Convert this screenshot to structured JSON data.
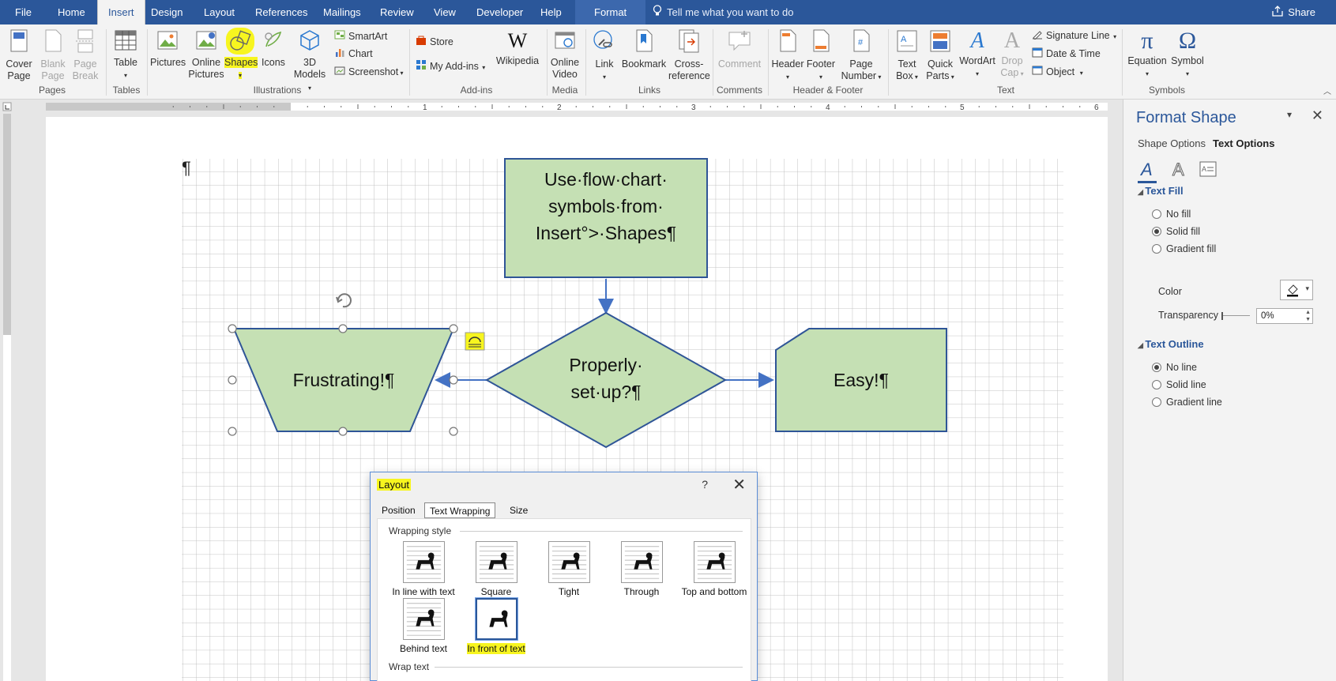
{
  "menubar": {
    "tabs": [
      "File",
      "Home",
      "Insert",
      "Design",
      "Layout",
      "References",
      "Mailings",
      "Review",
      "View",
      "Developer",
      "Help",
      "Format"
    ],
    "active_tab": "Insert",
    "tellme": "Tell me what you want to do",
    "share": "Share"
  },
  "ribbon": {
    "pages": {
      "cover_page": "Cover\nPage",
      "blank_page": "Blank\nPage",
      "page_break": "Page\nBreak",
      "label": "Pages"
    },
    "tables": {
      "table": "Table",
      "label": "Tables"
    },
    "illustrations": {
      "pictures": "Pictures",
      "online_pictures": "Online\nPictures",
      "shapes": "Shapes",
      "icons": "Icons",
      "models3d": "3D\nModels",
      "smartart": "SmartArt",
      "chart": "Chart",
      "screenshot": "Screenshot",
      "label": "Illustrations"
    },
    "addins": {
      "store": "Store",
      "my_addins": "My Add-ins",
      "wikipedia": "Wikipedia",
      "label": "Add-ins"
    },
    "media": {
      "online_video": "Online\nVideo",
      "label": "Media"
    },
    "links": {
      "link": "Link",
      "bookmark": "Bookmark",
      "cross_reference": "Cross-\nreference",
      "label": "Links"
    },
    "comments": {
      "comment": "Comment",
      "label": "Comments"
    },
    "header_footer": {
      "header": "Header",
      "footer": "Footer",
      "page_number": "Page\nNumber",
      "label": "Header & Footer"
    },
    "text": {
      "text_box": "Text\nBox",
      "quick_parts": "Quick\nParts",
      "wordart": "WordArt",
      "drop_cap": "Drop\nCap",
      "signature_line": "Signature Line",
      "date_time": "Date & Time",
      "object": "Object",
      "label": "Text"
    },
    "symbols": {
      "equation": "Equation",
      "symbol": "Symbol",
      "label": "Symbols"
    }
  },
  "document": {
    "pilcrow": "¶",
    "shapes": {
      "top": "Use·flow·chart·\nsymbols·from·\nInsert°>·Shapes¶",
      "left": "Frustrating!¶",
      "diamond": "Properly·\nset·up?¶",
      "right": "Easy!¶"
    },
    "colors": {
      "fill": "#c5e0b4",
      "outline": "#2f5597",
      "grid": "#b4b4b4"
    }
  },
  "pane": {
    "title": "Format Shape",
    "tabs": [
      "Shape Options",
      "Text Options"
    ],
    "active_tab": "Text Options",
    "text_fill": {
      "label": "Text Fill",
      "options": [
        "No fill",
        "Solid fill",
        "Gradient fill"
      ],
      "selected": "Solid fill",
      "color_label": "Color",
      "transparency_label": "Transparency",
      "transparency_value": "0%"
    },
    "text_outline": {
      "label": "Text Outline",
      "options": [
        "No line",
        "Solid line",
        "Gradient line"
      ],
      "selected": "No line"
    }
  },
  "dialog": {
    "title": "Layout",
    "help": "?",
    "tabs": [
      "Position",
      "Text Wrapping",
      "Size"
    ],
    "active_tab": "Text Wrapping",
    "wrapping_style_label": "Wrapping style",
    "styles": [
      "In line with text",
      "Square",
      "Tight",
      "Through",
      "Top and bottom",
      "Behind text",
      "In front of text"
    ],
    "selected_style": "In front of text",
    "wrap_text_label": "Wrap text"
  }
}
